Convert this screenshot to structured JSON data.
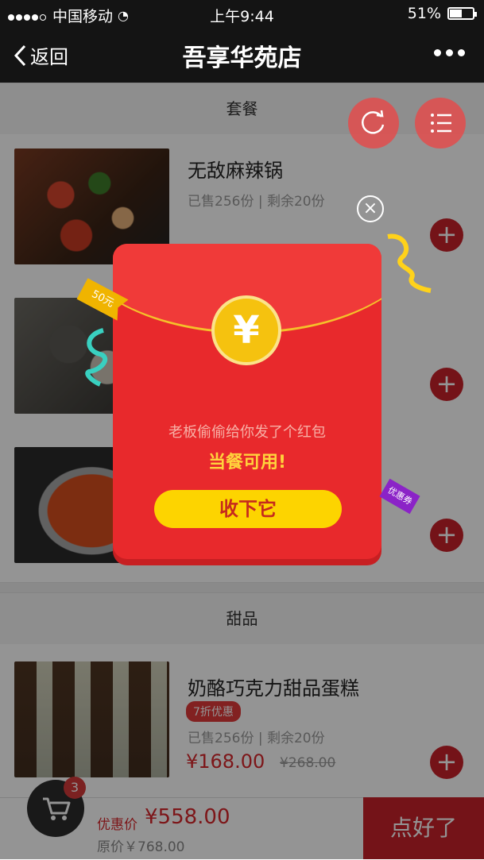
{
  "status_bar": {
    "carrier": "中国移动",
    "time": "上午9:44",
    "battery": "51%"
  },
  "nav": {
    "back_label": "返回",
    "title": "吾享华苑店"
  },
  "sections": [
    {
      "title": "套餐",
      "items": [
        {
          "name": "无敌麻辣锅",
          "sold": "已售256份 | 剩余20份"
        },
        {
          "name": "",
          "sold": ""
        },
        {
          "name": "",
          "sold": ""
        }
      ]
    },
    {
      "title": "甜品",
      "items": [
        {
          "name": "奶酪巧克力甜品蛋糕",
          "tag": "7折优惠",
          "sold": "已售256份 | 剩余20份",
          "price": "¥168.00",
          "old_price": "¥268.00"
        }
      ]
    }
  ],
  "cart": {
    "count": "3",
    "discount_label": "优惠价",
    "discount_price": "¥558.00",
    "original": "原价￥768.00",
    "submit_label": "点好了"
  },
  "popup": {
    "ribbon": "50元",
    "coupon": "优惠券",
    "coin_symbol": "¥",
    "message": "老板偷偷给你发了个红包",
    "highlight": "当餐可用!",
    "accept_label": "收下它",
    "close_symbol": "×"
  },
  "colors": {
    "brand_red": "#c8222a",
    "packet_red": "#e8292c",
    "gold": "#fdd400"
  }
}
